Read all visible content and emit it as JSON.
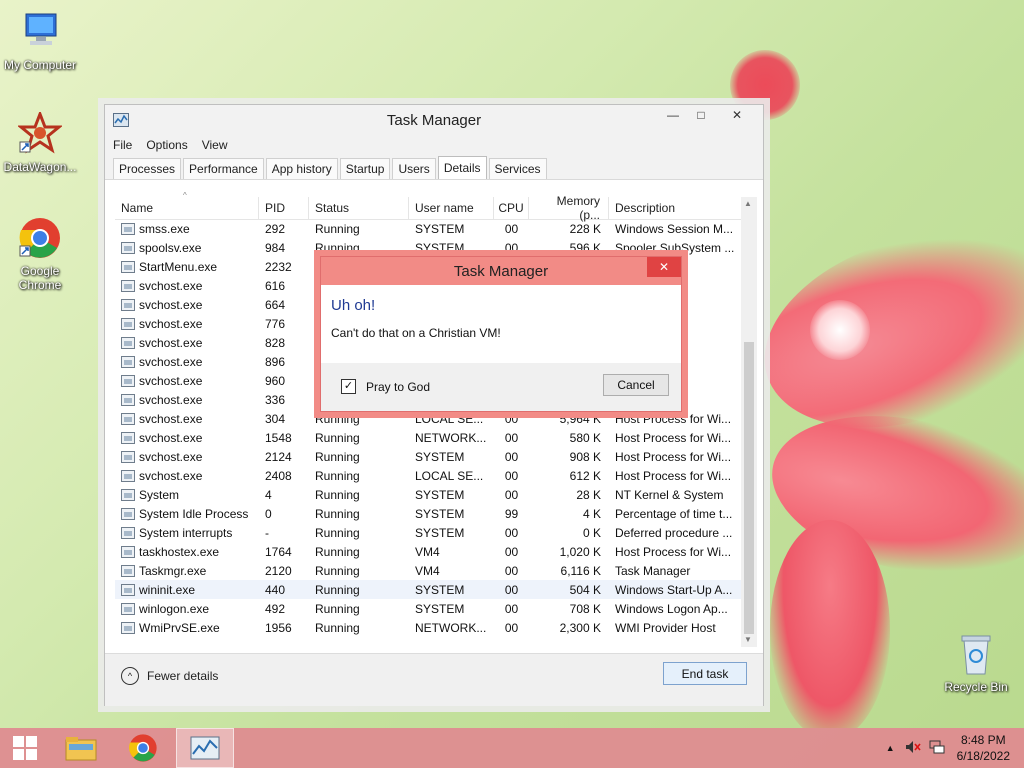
{
  "desktop": {
    "icons": [
      {
        "label": "My Computer"
      },
      {
        "label": "DataWagon..."
      },
      {
        "label": "Google Chrome"
      },
      {
        "label": "Recycle Bin"
      }
    ]
  },
  "window": {
    "title": "Task Manager",
    "menu": [
      "File",
      "Options",
      "View"
    ],
    "tabs": [
      "Processes",
      "Performance",
      "App history",
      "Startup",
      "Users",
      "Details",
      "Services"
    ],
    "active_tab": "Details",
    "columns": [
      "Name",
      "PID",
      "Status",
      "User name",
      "CPU",
      "Memory (p...",
      "Description"
    ],
    "rows": [
      {
        "name": "smss.exe",
        "pid": "292",
        "status": "Running",
        "user": "SYSTEM",
        "cpu": "00",
        "mem": "228 K",
        "desc": "Windows Session M..."
      },
      {
        "name": "spoolsv.exe",
        "pid": "984",
        "status": "Running",
        "user": "SYSTEM",
        "cpu": "00",
        "mem": "596 K",
        "desc": "Spooler SubSystem ..."
      },
      {
        "name": "StartMenu.exe",
        "pid": "2232",
        "status": "R",
        "user": "",
        "cpu": "",
        "mem": "",
        "desc": "enu"
      },
      {
        "name": "svchost.exe",
        "pid": "616",
        "status": "R",
        "user": "",
        "cpu": "",
        "mem": "",
        "desc": "for Wi..."
      },
      {
        "name": "svchost.exe",
        "pid": "664",
        "status": "R",
        "user": "",
        "cpu": "",
        "mem": "",
        "desc": "for Wi..."
      },
      {
        "name": "svchost.exe",
        "pid": "776",
        "status": "R",
        "user": "",
        "cpu": "",
        "mem": "",
        "desc": "for Wi..."
      },
      {
        "name": "svchost.exe",
        "pid": "828",
        "status": "R",
        "user": "",
        "cpu": "",
        "mem": "",
        "desc": "for Wi..."
      },
      {
        "name": "svchost.exe",
        "pid": "896",
        "status": "R",
        "user": "",
        "cpu": "",
        "mem": "",
        "desc": "for Wi..."
      },
      {
        "name": "svchost.exe",
        "pid": "960",
        "status": "R",
        "user": "",
        "cpu": "",
        "mem": "",
        "desc": "for Wi..."
      },
      {
        "name": "svchost.exe",
        "pid": "336",
        "status": "R",
        "user": "",
        "cpu": "",
        "mem": "",
        "desc": "for Wi..."
      },
      {
        "name": "svchost.exe",
        "pid": "304",
        "status": "Running",
        "user": "LOCAL SE...",
        "cpu": "00",
        "mem": "5,964 K",
        "desc": "Host Process for Wi..."
      },
      {
        "name": "svchost.exe",
        "pid": "1548",
        "status": "Running",
        "user": "NETWORK...",
        "cpu": "00",
        "mem": "580 K",
        "desc": "Host Process for Wi..."
      },
      {
        "name": "svchost.exe",
        "pid": "2124",
        "status": "Running",
        "user": "SYSTEM",
        "cpu": "00",
        "mem": "908 K",
        "desc": "Host Process for Wi..."
      },
      {
        "name": "svchost.exe",
        "pid": "2408",
        "status": "Running",
        "user": "LOCAL SE...",
        "cpu": "00",
        "mem": "612 K",
        "desc": "Host Process for Wi..."
      },
      {
        "name": "System",
        "pid": "4",
        "status": "Running",
        "user": "SYSTEM",
        "cpu": "00",
        "mem": "28 K",
        "desc": "NT Kernel & System"
      },
      {
        "name": "System Idle Process",
        "pid": "0",
        "status": "Running",
        "user": "SYSTEM",
        "cpu": "99",
        "mem": "4 K",
        "desc": "Percentage of time t..."
      },
      {
        "name": "System interrupts",
        "pid": "-",
        "status": "Running",
        "user": "SYSTEM",
        "cpu": "00",
        "mem": "0 K",
        "desc": "Deferred procedure ..."
      },
      {
        "name": "taskhostex.exe",
        "pid": "1764",
        "status": "Running",
        "user": "VM4",
        "cpu": "00",
        "mem": "1,020 K",
        "desc": "Host Process for Wi..."
      },
      {
        "name": "Taskmgr.exe",
        "pid": "2120",
        "status": "Running",
        "user": "VM4",
        "cpu": "00",
        "mem": "6,116 K",
        "desc": "Task Manager"
      },
      {
        "name": "wininit.exe",
        "pid": "440",
        "status": "Running",
        "user": "SYSTEM",
        "cpu": "00",
        "mem": "504 K",
        "desc": "Windows Start-Up A..."
      },
      {
        "name": "winlogon.exe",
        "pid": "492",
        "status": "Running",
        "user": "SYSTEM",
        "cpu": "00",
        "mem": "708 K",
        "desc": "Windows Logon Ap..."
      },
      {
        "name": "WmiPrvSE.exe",
        "pid": "1956",
        "status": "Running",
        "user": "NETWORK...",
        "cpu": "00",
        "mem": "2,300 K",
        "desc": "WMI Provider Host"
      }
    ],
    "selected_row": "wininit.exe",
    "fewer_details": "Fewer details",
    "end_task": "End task"
  },
  "dialog": {
    "title": "Task Manager",
    "heading": "Uh oh!",
    "message": "Can't do that on a Christian VM!",
    "checkbox_label": "Pray to God",
    "checkbox_checked": true,
    "cancel": "Cancel"
  },
  "taskbar": {
    "time": "8:48 PM",
    "date": "6/18/2022"
  },
  "colors": {
    "dialog_accent": "#f28b86",
    "taskbar": "#de8c90",
    "heading_blue": "#1f3a93"
  }
}
